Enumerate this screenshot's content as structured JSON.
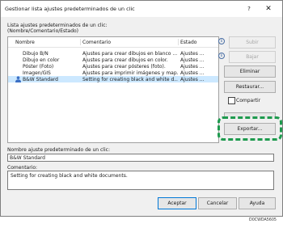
{
  "window": {
    "title": "Gestionar lista ajustes predeterminados de un clic",
    "help_glyph": "?",
    "close_glyph": "✕"
  },
  "list": {
    "label_line1": "Lista ajustes predeterminados de un clic:",
    "label_line2": "(Nombre/Comentario/Estado)",
    "columns": [
      "Nombre",
      "Comentario",
      "Estado"
    ],
    "rows": [
      {
        "name": "Dibujo B/N",
        "comment": "Ajustes para crear dibujos en blanco ...",
        "status": "Ajustes ...",
        "selected": false,
        "icon": ""
      },
      {
        "name": "Dibujo en color",
        "comment": "Ajustes para crear dibujos en color.",
        "status": "Ajustes ...",
        "selected": false,
        "icon": ""
      },
      {
        "name": "Póster (Foto)",
        "comment": "Ajustes para crear pósteres (foto).",
        "status": "Ajustes ...",
        "selected": false,
        "icon": ""
      },
      {
        "name": "Imagen/GIS",
        "comment": "Ajustes para imprimir imágenes y map...",
        "status": "Ajustes ...",
        "selected": false,
        "icon": ""
      },
      {
        "name": "B&W Standard",
        "comment": "Setting for creating black and white d...",
        "status": "Ajustes ...",
        "selected": true,
        "icon": "user-icon"
      }
    ]
  },
  "buttons": {
    "up": "Subir",
    "down": "Bajar",
    "delete": "Eliminar",
    "restore": "Restaurar...",
    "share": "Compartir",
    "export": "Exportar...",
    "ok": "Aceptar",
    "cancel": "Cancelar",
    "help": "Ayuda"
  },
  "name_field": {
    "label": "Nombre ajuste predeterminado de un clic:",
    "value": "B&W Standard"
  },
  "comment_field": {
    "label": "Comentario:",
    "value": "Setting for creating black and white documents."
  },
  "footnote": "D0CWDA5605",
  "colors": {
    "selection": "#cce8ff",
    "highlight": "#1e9a4e",
    "user_icon": "#3b6fc4"
  }
}
